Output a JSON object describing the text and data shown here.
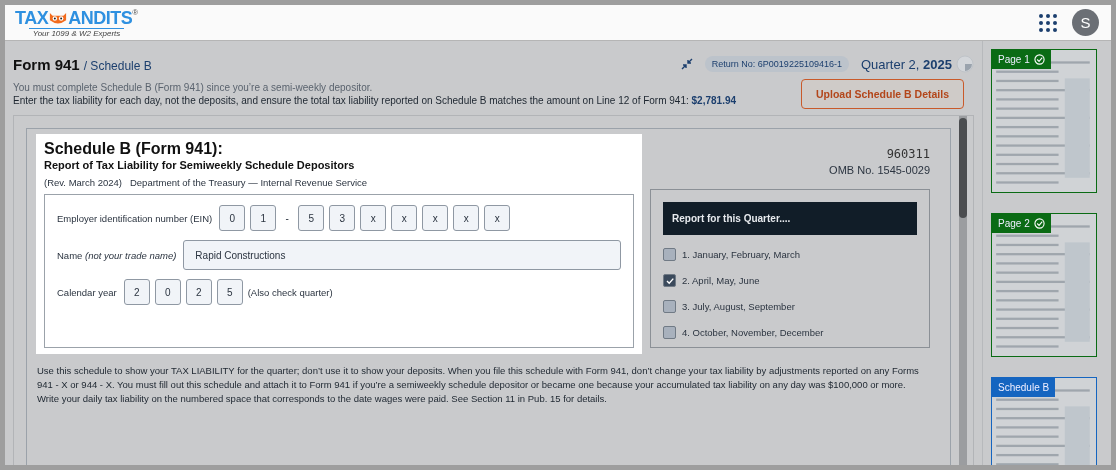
{
  "header": {
    "logo": {
      "left": "TAX",
      "right": "ANDITS",
      "mark": "®",
      "tagline": "Your 1099 & W2 Experts"
    },
    "avatar": "S"
  },
  "page": {
    "title": "Form 941",
    "subtitle": "/ Schedule B",
    "return_no": "Return No: 6P0019225109416-1",
    "quarter": "Quarter 2,",
    "year": "2025"
  },
  "notes": [
    "You must complete Schedule B (Form 941) since you’re a semi-weekly depositor.",
    "Enter the tax liability for each day, not the deposits, and ensure the total tax liability reported on Schedule B matches the amount on Line 12 of Form 941:"
  ],
  "amount": "$2,781.94",
  "upload_button": "Upload Schedule B Details",
  "form": {
    "title": "Schedule B (Form 941):",
    "subtitle": "Report of Tax Liability for Semiweekly Schedule Depositors",
    "revision": "(Rev. March 2024)",
    "department": "Department of the Treasury — Internal Revenue Service",
    "code": "960311",
    "omb": "OMB No. 1545-0029",
    "ein_label": "Employer identification number (EIN)",
    "ein": [
      {
        "kind": "box",
        "text": "0"
      },
      {
        "kind": "box",
        "text": "1"
      },
      {
        "kind": "sep",
        "text": "-"
      },
      {
        "kind": "box",
        "text": "5"
      },
      {
        "kind": "box",
        "text": "3"
      },
      {
        "kind": "box",
        "text": "x"
      },
      {
        "kind": "box",
        "text": "x"
      },
      {
        "kind": "box",
        "text": "x"
      },
      {
        "kind": "box",
        "text": "x"
      },
      {
        "kind": "box",
        "text": "x"
      }
    ],
    "name_label": "Name *(not your trade name)*",
    "name_value": "Rapid Constructions",
    "year_label": "Calendar year",
    "year_digits": [
      "2",
      "0",
      "2",
      "5"
    ],
    "year_note": "(Also check quarter)",
    "quarter_heading": "Report for this Quarter....",
    "quarters": [
      {
        "label": "1. January, February, March",
        "checked": false
      },
      {
        "label": "2. April, May, June",
        "checked": true
      },
      {
        "label": "3. July, August, September",
        "checked": false
      },
      {
        "label": "4. October, November, December",
        "checked": false
      }
    ],
    "instructions": "Use this schedule to show your TAX LIABILITY for the quarter; don’t use it to show your deposits. When you file this schedule with Form 941, don’t change your tax liability by adjustments reported on any Forms 941 - X or 944 - X. You must fill out this schedule and attach it to Form 941 if you’re a semiweekly schedule depositor or became one because your accumulated tax liability on any day was $100,000 or more. Write your daily tax liability on the numbered space that corresponds to the date wages were paid. See Section 11 in Pub. 15 for details."
  },
  "thumbnails": [
    {
      "label": "Page 1",
      "completed": true,
      "color": "#0a6b14"
    },
    {
      "label": "Page 2",
      "completed": true,
      "color": "#0a6b14"
    },
    {
      "label": "Schedule B",
      "completed": false,
      "color": "#1565c0"
    }
  ]
}
